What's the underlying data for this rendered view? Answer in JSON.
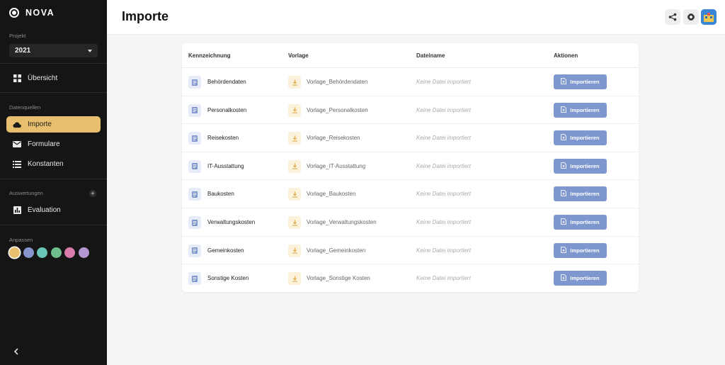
{
  "app": {
    "name": "NOVA"
  },
  "sidebar": {
    "project_label": "Projekt",
    "project_value": "2021",
    "overview_label": "Übersicht",
    "datasources_label": "Datenquellen",
    "nav": [
      {
        "label": "Importe",
        "icon": "cloud-icon",
        "active": true
      },
      {
        "label": "Formulare",
        "icon": "mail-icon",
        "active": false
      },
      {
        "label": "Konstanten",
        "icon": "list-icon",
        "active": false
      }
    ],
    "evaluations_label": "Auswertungen",
    "evaluation_label": "Evaluation",
    "customize_label": "Anpassen",
    "swatches": [
      "#e7bf6e",
      "#8795cf",
      "#69c6b9",
      "#6fbf8c",
      "#d97cab",
      "#b497d0"
    ]
  },
  "header": {
    "title": "Importe"
  },
  "table": {
    "columns": [
      "Kennzeichnung",
      "Vorlage",
      "Dateiname",
      "Aktionen"
    ],
    "button_label": "Importieren",
    "rows": [
      {
        "name": "Behördendaten",
        "template": "Vorlage_Behördendaten",
        "file": "Keine Datei importiert"
      },
      {
        "name": "Personalkosten",
        "template": "Vorlage_Personalkosten",
        "file": "Keine Datei importiert"
      },
      {
        "name": "Reisekosten",
        "template": "Vorlage_Reisekosten",
        "file": "Keine Datei importiert"
      },
      {
        "name": "IT-Ausstattung",
        "template": "Vorlage_IT-Ausstattung",
        "file": "Keine Datei importiert"
      },
      {
        "name": "Baukosten",
        "template": "Vorlage_Baukosten",
        "file": "Keine Datei importiert"
      },
      {
        "name": "Verwaltungskosten",
        "template": "Vorlage_Verwaltungskosten",
        "file": "Keine Datei importiert"
      },
      {
        "name": "Gemeinkosten",
        "template": "Vorlage_Gemeinkosten",
        "file": "Keine Datei importiert"
      },
      {
        "name": "Sonstige Kosten",
        "template": "Vorlage_Sonstige Kosten",
        "file": "Keine Datei importiert"
      }
    ]
  },
  "colors": {
    "accent": "#e7bf6e",
    "button": "#7f97cf",
    "sidebar": "#151515"
  }
}
